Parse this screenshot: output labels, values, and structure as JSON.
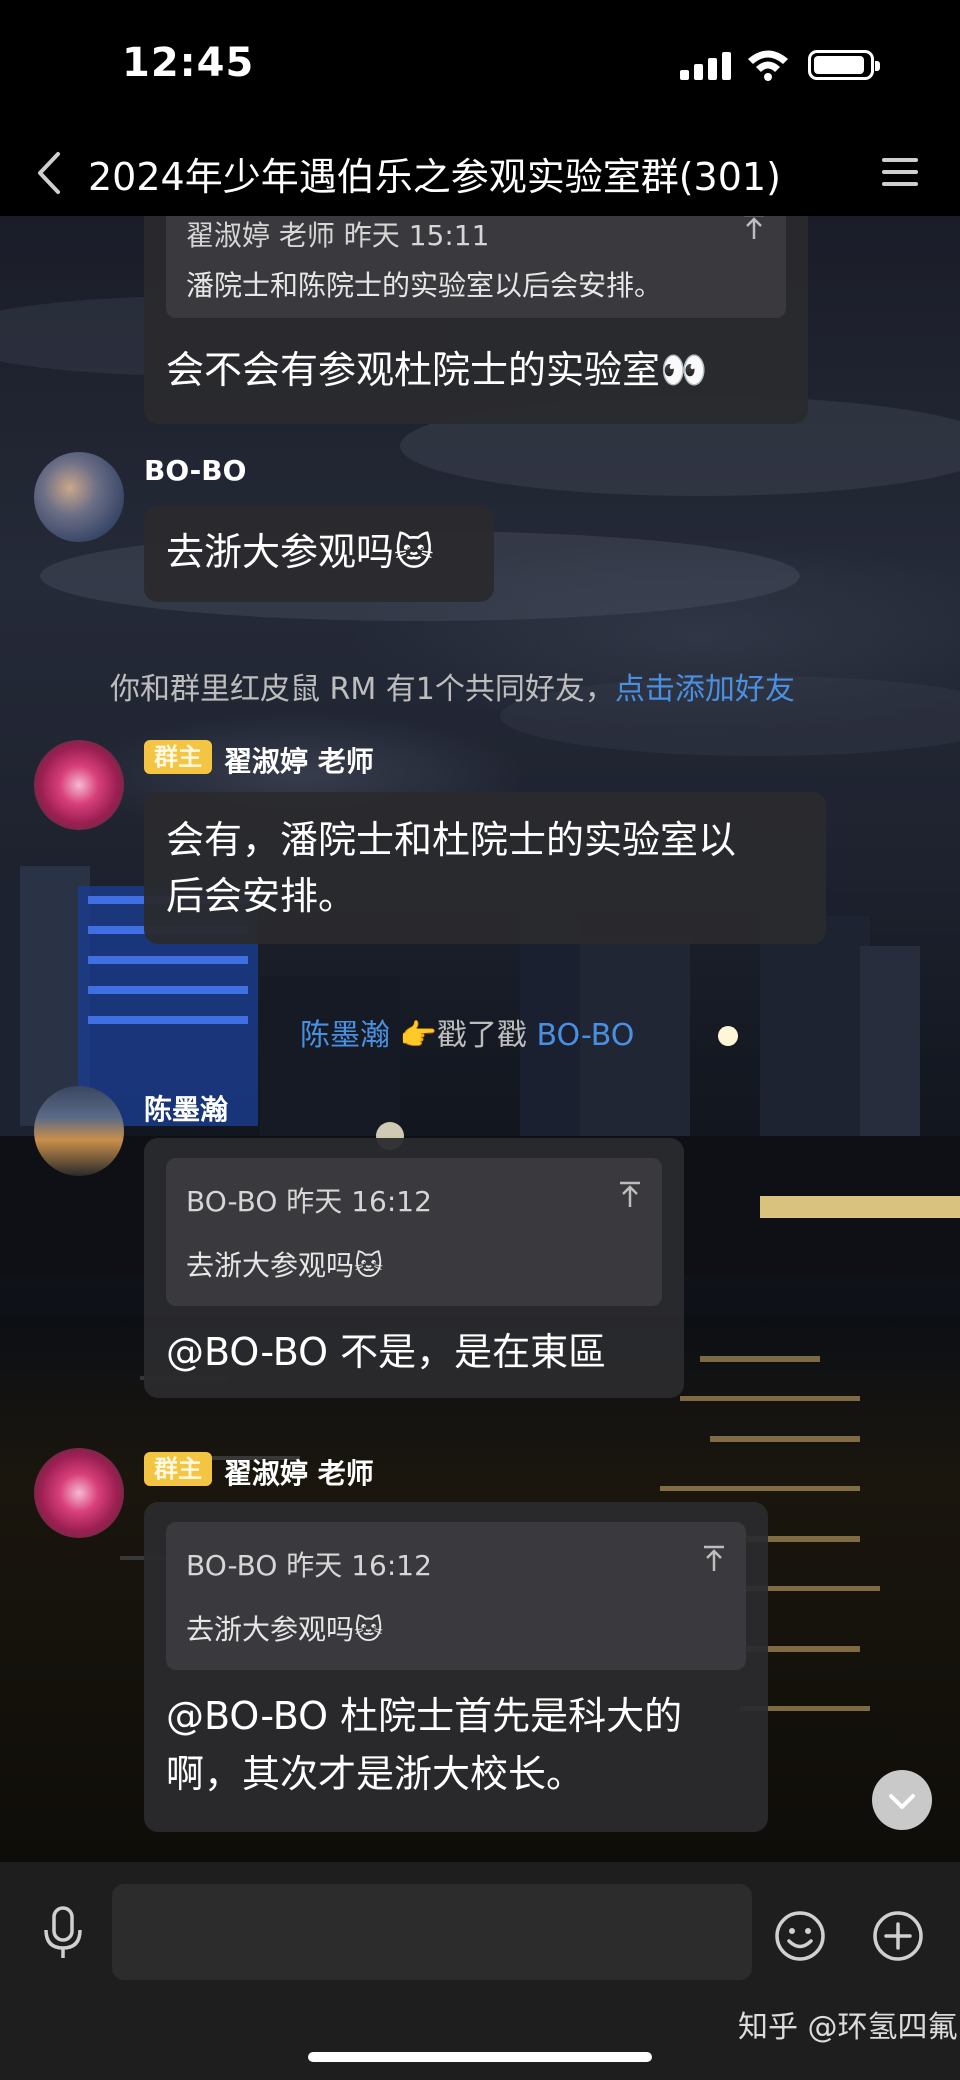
{
  "status_bar": {
    "time": "12:45"
  },
  "header": {
    "title": "2024年少年遇伯乐之参观实验室群(301)"
  },
  "messages": {
    "m1": {
      "quote_meta": "翟淑婷 老师 昨天 15:11",
      "quote_text": "潘院士和陈院士的实验室以后会安排。",
      "text": "会不会有参观杜院士的实验室👀"
    },
    "m2": {
      "sender": "BO-BO",
      "text": "去浙大参观吗🐱"
    },
    "system1": {
      "text": "你和群里红皮鼠 RM 有1个共同好友，",
      "link": "点击添加好友"
    },
    "m3": {
      "badge": "群主",
      "sender": "翟淑婷 老师",
      "line1": "会有，潘院士和杜院士的实验室以",
      "line2": "后会安排。"
    },
    "system2": {
      "actor": "陈墨瀚",
      "emoji": "👉",
      "action": "戳了戳",
      "target": "BO-BO"
    },
    "m4": {
      "sender": "陈墨瀚",
      "quote_meta": "BO-BO 昨天 16:12",
      "quote_text": "去浙大参观吗🐱",
      "text": "@BO-BO 不是，是在東區"
    },
    "m5": {
      "badge": "群主",
      "sender": "翟淑婷 老师",
      "quote_meta": "BO-BO 昨天 16:12",
      "quote_text": "去浙大参观吗🐱",
      "line1": "@BO-BO 杜院士首先是科大的",
      "line2": "啊，其次才是浙大校长。"
    }
  },
  "input": {
    "placeholder": ""
  },
  "watermark": "知乎 @环氢四氟",
  "colors": {
    "link": "#4a90e2",
    "badge": "#f4c542",
    "bubble": "#2b2b2e"
  }
}
